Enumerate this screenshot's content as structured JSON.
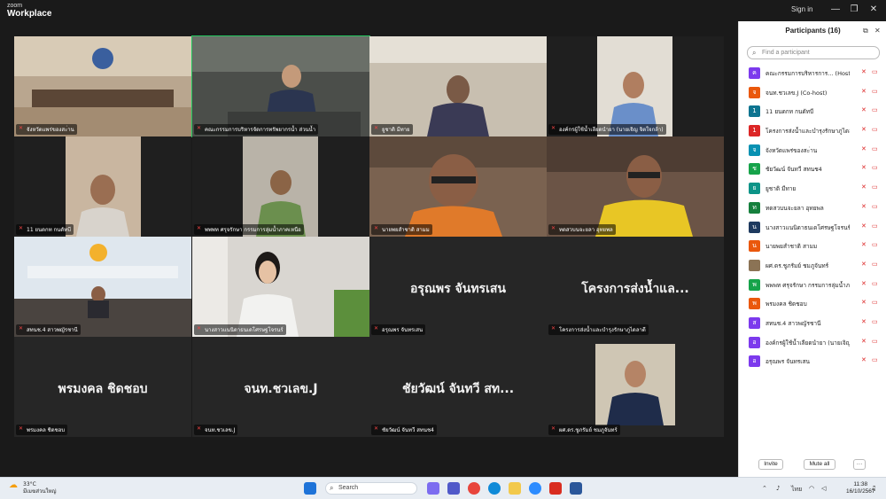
{
  "app": {
    "brand_line1": "zoom",
    "brand_line2": "Workplace",
    "sign_in": "Sign in",
    "win_min": "—",
    "win_max": "❐",
    "win_close": "✕"
  },
  "tiles": [
    {
      "label": "จังหวัดแพร่ของสะ่าน",
      "big": ""
    },
    {
      "label": "คณะกรรมการบริหารจัดการทรัพยากรน้ำ ส่วนน้ำ",
      "big": ""
    },
    {
      "label": "ยูชาติ มีทาย",
      "big": ""
    },
    {
      "label": "องค์กรผู้ใช้น้ำเลียดนำยา (นายเจิญ จิตใจกล้า)",
      "big": ""
    },
    {
      "label": "11 ยนดกท กนดัทบี",
      "big": ""
    },
    {
      "label": "พพพท ศรุจรักษา กรรมการลุ่มน้ำภาคเหนือ",
      "big": ""
    },
    {
      "label": "นายพยสำชาติ สามม",
      "big": ""
    },
    {
      "label": "ทดสวบนจะยลา อุทยพล",
      "big": ""
    },
    {
      "label": "สทนช.4 สาวพญัรชานี",
      "big": ""
    },
    {
      "label": "นางสาวแนนิดาธนเดโศรษฐโจรนร์",
      "big": ""
    },
    {
      "label": "อรุณพร จันทรเสน",
      "big": "อรุณพร จันทรเสน"
    },
    {
      "label": "โครงการส่งน้ำและบำรุงรักษาภูไดลาดี",
      "big": "โครงการส่งน้ำแล..."
    },
    {
      "label": "พรมงคล ชิดชอบ",
      "big": "พรมงคล ชิดชอบ"
    },
    {
      "label": "จนท.ชวเลข.J",
      "big": "จนท.ชวเลข.J"
    },
    {
      "label": "ชัยวัฒน์ จันทวี สทนช4",
      "big": "ชัยวัฒน์ จันทวี สท..."
    },
    {
      "label": "ผศ.ดร.ชูภรัมย์ ชมภูจันทร์",
      "big": ""
    }
  ],
  "panel": {
    "title": "Participants (16)",
    "search_placeholder": "Find a participant",
    "invite": "Invite",
    "mute_all": "Mute all",
    "more": "···",
    "participants": [
      {
        "name": "คณะกรรมการบริหารการ... (Host, me)",
        "initial": "ค",
        "color": "#7c3aed"
      },
      {
        "name": "จนท.ชวเลข.J (Co-host)",
        "initial": "จ",
        "color": "#ea580c"
      },
      {
        "name": "11 ยนดกท กนดัทบี",
        "initial": "1",
        "color": "#0e7490"
      },
      {
        "name": "โครงการส่งน้ำและบำรุงรักษาภูไดลาดี",
        "initial": "1",
        "color": "#dc2626"
      },
      {
        "name": "จังหวัดแพร่ของสะ่าน",
        "initial": "จ",
        "color": "#0891b2"
      },
      {
        "name": "ชัยวัฒน์ จันทวี สทนช4",
        "initial": "ช",
        "color": "#16a34a"
      },
      {
        "name": "ยูชาติ มีทาย",
        "initial": "ย",
        "color": "#0d9488"
      },
      {
        "name": "ทดสวบนจะยลา อุทยพล",
        "initial": "ท",
        "color": "#15803d"
      },
      {
        "name": "นางสาวแนนิดาธนเดโศรษฐโจรนร์",
        "initial": "น",
        "color": "#1e3a5f"
      },
      {
        "name": "นายพยสำชาติ สามม",
        "initial": "น",
        "color": "#ea580c"
      },
      {
        "name": "ผศ.ดร.ชูภรัมย์ ชมภูจันทร์",
        "initial": "",
        "color": "#8b7355"
      },
      {
        "name": "พพพท ศรุจรักษา กรรมการลุ่มน้ำภาคเ...",
        "initial": "พ",
        "color": "#16a34a"
      },
      {
        "name": "พรมงคล ชิดชอบ",
        "initial": "พ",
        "color": "#ea580c"
      },
      {
        "name": "สทนช.4 สาวพญัรชานี",
        "initial": "ส",
        "color": "#7c3aed"
      },
      {
        "name": "องค์กรผู้ใช้น้ำเลียดนำยา (นายเจิญ จิตใ...",
        "initial": "อ",
        "color": "#7c3aed"
      },
      {
        "name": "อรุณพร จันทรเสน",
        "initial": "อ",
        "color": "#7c3aed"
      }
    ]
  },
  "taskbar": {
    "temp": "33°C",
    "weather": "มีเมฆส่วนใหญ่",
    "search": "Search",
    "lang": "ไทย",
    "time": "11:38",
    "date": "16/10/2567"
  }
}
